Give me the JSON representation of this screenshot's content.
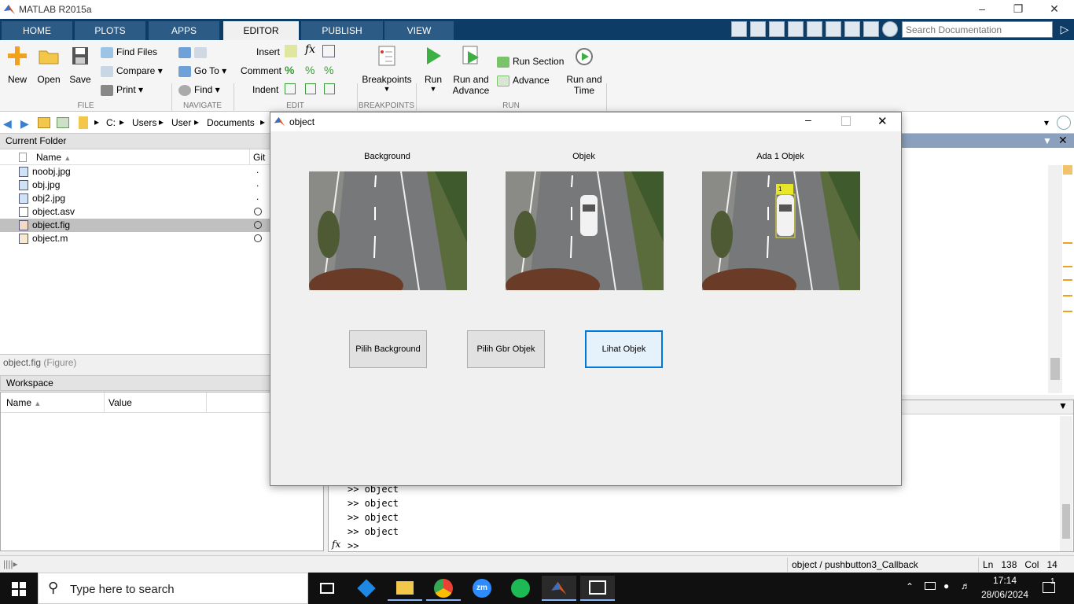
{
  "window": {
    "title": "MATLAB R2015a"
  },
  "ribbon_tabs": [
    "HOME",
    "PLOTS",
    "APPS",
    "EDITOR",
    "PUBLISH",
    "VIEW"
  ],
  "active_tab": "EDITOR",
  "search": {
    "placeholder": "Search Documentation"
  },
  "file_group": {
    "new": "New",
    "open": "Open",
    "save": "Save",
    "find_files": "Find Files",
    "compare": "Compare",
    "print": "Print",
    "label": "FILE"
  },
  "navigate_group": {
    "go_to": "Go To",
    "find": "Find",
    "label": "NAVIGATE"
  },
  "edit_group": {
    "insert": "Insert",
    "comment": "Comment",
    "indent": "Indent",
    "label": "EDIT"
  },
  "breakpoints_group": {
    "breakpoints": "Breakpoints",
    "label": "BREAKPOINTS"
  },
  "run_group": {
    "run": "Run",
    "run_and": "Run and",
    "advance": "Advance",
    "run_section": "Run Section",
    "advance_small": "Advance",
    "run_and2": "Run and",
    "time": "Time",
    "label": "RUN"
  },
  "path": [
    "C:",
    "Users",
    "User",
    "Documents"
  ],
  "current_folder": {
    "title": "Current Folder",
    "col_name": "Name",
    "col_git": "Git",
    "files": [
      {
        "name": "noobj.jpg",
        "type": "image",
        "git": "."
      },
      {
        "name": "obj.jpg",
        "type": "image",
        "git": "."
      },
      {
        "name": "obj2.jpg",
        "type": "image",
        "git": "."
      },
      {
        "name": "object.asv",
        "type": "doc",
        "git": "circle"
      },
      {
        "name": "object.fig",
        "type": "fig",
        "git": "circle",
        "selected": true
      },
      {
        "name": "object.m",
        "type": "m",
        "git": "circle"
      }
    ],
    "details_name": "object.fig",
    "details_type": "(Figure)"
  },
  "workspace": {
    "title": "Workspace",
    "col_name": "Name",
    "col_value": "Value"
  },
  "command_window": {
    "lines": [
      ">> object",
      ">> object",
      ">> object",
      ">> object"
    ],
    "prompt": ">>",
    "fx": "fx"
  },
  "statusbar": {
    "function": "object / pushbutton3_Callback",
    "ln_label": "Ln",
    "ln": "138",
    "col_label": "Col",
    "col": "14"
  },
  "figure": {
    "title": "object",
    "axes": [
      {
        "title": "Background",
        "has_car": false,
        "box": false
      },
      {
        "title": "Objek",
        "has_car": true,
        "box": false
      },
      {
        "title": "Ada 1 Objek",
        "has_car": true,
        "box": true,
        "box_label": "1"
      }
    ],
    "buttons": [
      {
        "label": "Pilih Background",
        "focused": false
      },
      {
        "label": "Pilih Gbr Objek",
        "focused": false
      },
      {
        "label": "Lihat Objek",
        "focused": true
      }
    ]
  },
  "taskbar": {
    "search_placeholder": "Type here to search",
    "time": "17:14",
    "date": "28/06/2024",
    "notifications": "1"
  }
}
